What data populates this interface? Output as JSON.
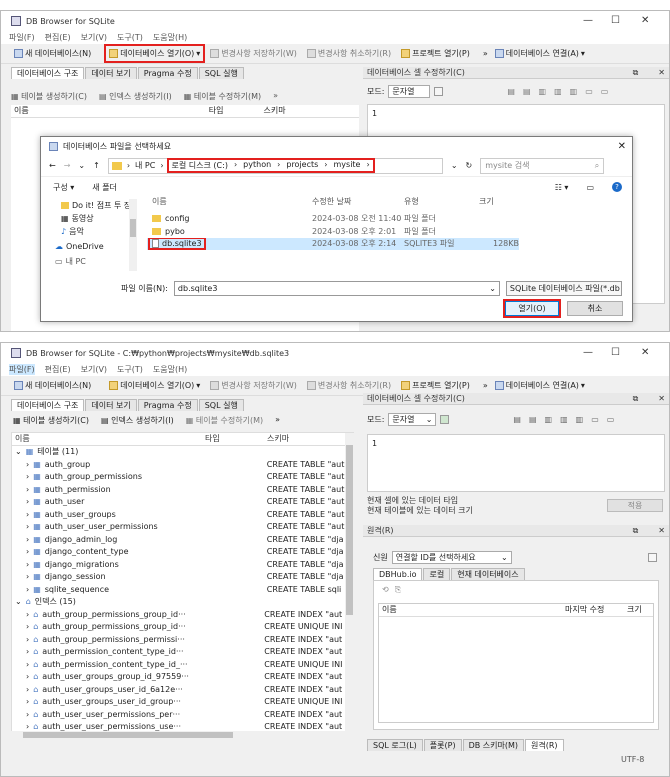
{
  "w1": {
    "title": "DB Browser for SQLite",
    "menu": [
      "파일(F)",
      "편집(E)",
      "보기(V)",
      "도구(T)",
      "도움말(H)"
    ],
    "toolbar": {
      "new_db": "새 데이터베이스(N)",
      "open_db": "데이터베이스 열기(O)",
      "write": "변경사항 저장하기(W)",
      "revert": "변경사항 취소하기(R)",
      "open_project": "프로젝트 열기(P)",
      "attach": "데이터베이스 연결(A)"
    },
    "tabs": [
      "데이터베이스 구조",
      "데이터 보기",
      "Pragma 수정",
      "SQL 실행"
    ],
    "subtool": {
      "create_table": "테이블 생성하기(C)",
      "create_index": "인덱스 생성하기(I)",
      "modify_table": "테이블 수정하기(M)"
    },
    "col_name": "이름",
    "edit_cell_title": "데이터베이스 셀 수정하기(C)",
    "mode_label": "모드:",
    "mode_value": "문자열",
    "line_no": "1"
  },
  "dialog": {
    "title": "데이터베이스 파일을 선택하세요",
    "path_root": "내 PC",
    "path": [
      "로컬 디스크 (C:)",
      "python",
      "projects",
      "mysite"
    ],
    "search_placeholder": "mysite 검색",
    "organize": "구성",
    "new_folder": "새 폴더",
    "nav": [
      "Do it! 점프 투 장",
      "동영상",
      "음악",
      "OneDrive",
      "내 PC"
    ],
    "headers": {
      "name": "이름",
      "date": "수정한 날짜",
      "type": "유형",
      "size": "크기"
    },
    "files": [
      {
        "name": "config",
        "date": "2024-03-08 오전 11:40",
        "type": "파일 폴더",
        "size": ""
      },
      {
        "name": "pybo",
        "date": "2024-03-08 오후 2:01",
        "type": "파일 폴더",
        "size": ""
      },
      {
        "name": "db.sqlite3",
        "date": "2024-03-08 오후 2:14",
        "type": "SQLITE3 파일",
        "size": "128KB"
      }
    ],
    "filename_label": "파일 이름(N):",
    "filename_value": "db.sqlite3",
    "filter": "SQLite 데이터베이스 파일(*.db",
    "open": "열기(O)",
    "cancel": "취소"
  },
  "w2": {
    "title": "DB Browser for SQLite - C:₩python₩projects₩mysite₩db.sqlite3",
    "menu": [
      "파일(F)",
      "편집(E)",
      "보기(V)",
      "도구(T)",
      "도움말(H)"
    ],
    "toolbar": {
      "new_db": "새 데이터베이스(N)",
      "open_db": "데이터베이스 열기(O)",
      "write": "변경사항 저장하기(W)",
      "revert": "변경사항 취소하기(R)",
      "open_project": "프로젝트 열기(P)",
      "attach": "데이터베이스 연결(A)"
    },
    "tabs": [
      "데이터베이스 구조",
      "데이터 보기",
      "Pragma 수정",
      "SQL 실행"
    ],
    "subtool": {
      "create_table": "테이블 생성하기(C)",
      "create_index": "인덱스 생성하기(I)",
      "modify_table": "테이블 수정하기(M)"
    },
    "cols": {
      "name": "이름",
      "type": "타입",
      "schema": "스키마"
    },
    "tables_group": "테이블 (11)",
    "tables": [
      {
        "name": "auth_group",
        "schema": "CREATE TABLE \"aut"
      },
      {
        "name": "auth_group_permissions",
        "schema": "CREATE TABLE \"aut"
      },
      {
        "name": "auth_permission",
        "schema": "CREATE TABLE \"aut"
      },
      {
        "name": "auth_user",
        "schema": "CREATE TABLE \"aut"
      },
      {
        "name": "auth_user_groups",
        "schema": "CREATE TABLE \"aut"
      },
      {
        "name": "auth_user_user_permissions",
        "schema": "CREATE TABLE \"aut"
      },
      {
        "name": "django_admin_log",
        "schema": "CREATE TABLE \"dja"
      },
      {
        "name": "django_content_type",
        "schema": "CREATE TABLE \"dja"
      },
      {
        "name": "django_migrations",
        "schema": "CREATE TABLE \"dja"
      },
      {
        "name": "django_session",
        "schema": "CREATE TABLE \"dja"
      },
      {
        "name": "sqlite_sequence",
        "schema": "CREATE TABLE sqli"
      }
    ],
    "index_group": "인덱스 (15)",
    "indexes": [
      {
        "name": "auth_group_permissions_group_id···",
        "schema": "CREATE INDEX \"aut"
      },
      {
        "name": "auth_group_permissions_group_id···",
        "schema": "CREATE UNIQUE INI"
      },
      {
        "name": "auth_group_permissions_permissi···",
        "schema": "CREATE INDEX \"aut"
      },
      {
        "name": "auth_permission_content_type_id···",
        "schema": "CREATE INDEX \"aut"
      },
      {
        "name": "auth_permission_content_type_id_···",
        "schema": "CREATE UNIQUE INI"
      },
      {
        "name": "auth_user_groups_group_id_97559···",
        "schema": "CREATE INDEX \"aut"
      },
      {
        "name": "auth_user_groups_user_id_6a12e···",
        "schema": "CREATE INDEX \"aut"
      },
      {
        "name": "auth_user_groups_user_id_group···",
        "schema": "CREATE UNIQUE INI"
      },
      {
        "name": "auth_user_user_permissions_per···",
        "schema": "CREATE INDEX \"aut"
      },
      {
        "name": "auth_user_user_permissions_use···",
        "schema": "CREATE INDEX \"aut"
      }
    ],
    "edit_cell_title": "데이터베이스 셀 수정하기(C)",
    "mode_label": "모드:",
    "mode_value": "문자열",
    "line_no": "1",
    "cell_type": "현재 셀에 있는 데이터 타입",
    "cell_size": "현재 테이블에 있는 데이터 크기",
    "apply": "적용",
    "remote_title": "원격(R)",
    "identity_label": "신원",
    "identity_value": "연결할 ID를 선택하세요",
    "remote_tabs": [
      "DBHub.io",
      "로컬",
      "현재 데이터베이스"
    ],
    "remote_cols": {
      "name": "이름",
      "modified": "마지막 수정",
      "size": "크기"
    },
    "bottom_tabs": [
      "SQL 로그(L)",
      "플롯(P)",
      "DB 스키마(M)",
      "원격(R)"
    ],
    "encoding": "UTF-8"
  }
}
